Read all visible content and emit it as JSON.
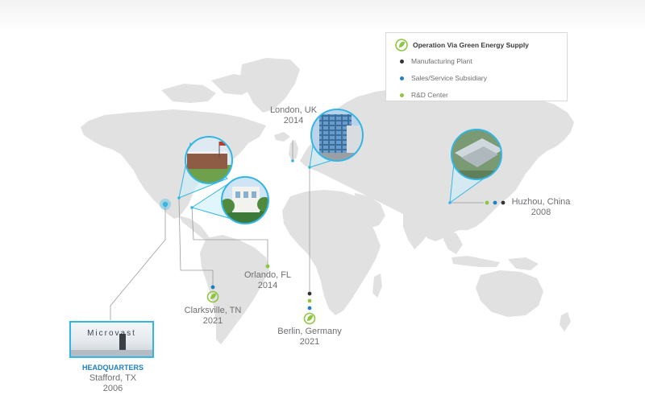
{
  "legend": {
    "items": [
      {
        "label": "Operation Via Green Energy Supply",
        "icon": "green-leaf-icon"
      },
      {
        "label": "Manufacturing Plant",
        "color": "#333333"
      },
      {
        "label": "Sales/Service Subsidiary",
        "color": "#1e7fc2"
      },
      {
        "label": "R&D Center",
        "color": "#8dc63f"
      }
    ]
  },
  "locations": {
    "headquarters": {
      "tag": "HEADQUARTERS",
      "city": "Stafford, TX",
      "year": "2006",
      "sign": "Microvast"
    },
    "clarksville": {
      "city": "Clarksville, TN",
      "year": "2021"
    },
    "orlando": {
      "city": "Orlando, FL",
      "year": "2014"
    },
    "london": {
      "city": "London, UK",
      "year": "2014"
    },
    "berlin": {
      "city": "Berlin, Germany",
      "year": "2021"
    },
    "huzhou": {
      "city": "Huzhou, China",
      "year": "2008"
    }
  },
  "colors": {
    "accent": "#34b6e4",
    "land": "#e1e1e1",
    "manufacturing": "#333333",
    "sales": "#1e7fc2",
    "rnd": "#8dc63f"
  }
}
